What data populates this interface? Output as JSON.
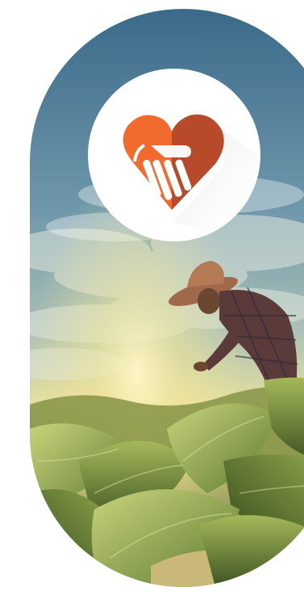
{
  "screen": {
    "description_type": "splash",
    "background": "#ffffff"
  },
  "hero": {
    "image_subject": "farmer-in-tobacco-field-at-sunset",
    "colors": {
      "sky_top": "#3f6f8e",
      "sky_mid": "#8fb0b8",
      "horizon_glow": "#f6e8a0",
      "leaf_light": "#b7c46a",
      "leaf_dark": "#3f5a25"
    }
  },
  "logo": {
    "icon": "heart-hand-icon",
    "colors": {
      "heart_left": "#f26a2e",
      "heart_right": "#b64a2a",
      "hand": "#ffffff",
      "shadow": "#e6e6e6",
      "badge_bg": "#ffffff"
    }
  }
}
